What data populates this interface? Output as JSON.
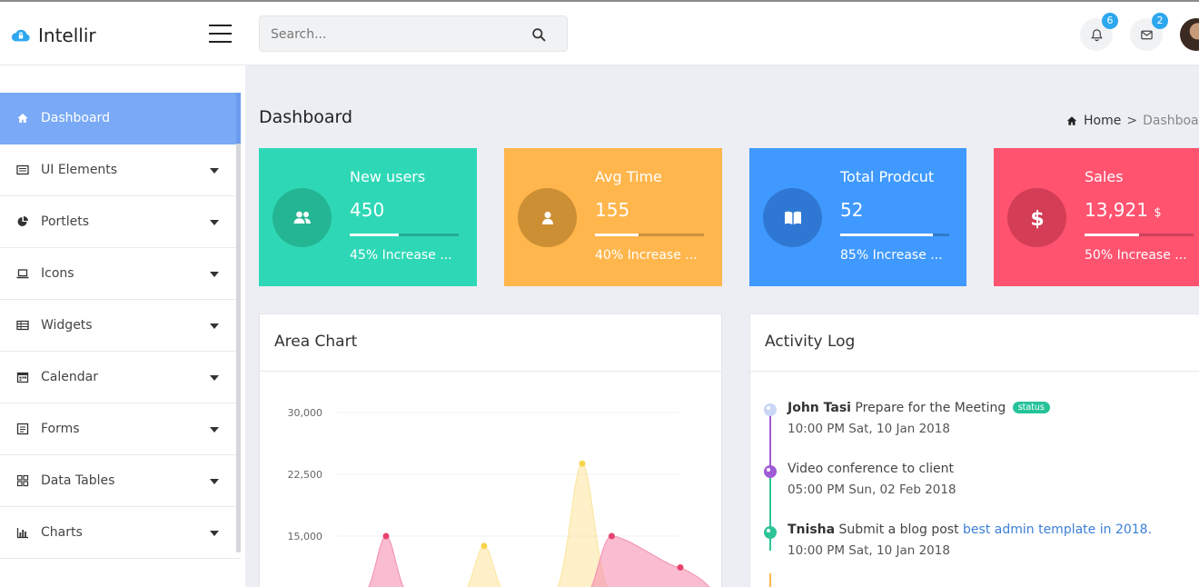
{
  "app": {
    "name": "Intellir"
  },
  "search": {
    "placeholder": "Search..."
  },
  "header": {
    "notifications_count": "6",
    "messages_count": "2"
  },
  "sidebar": {
    "items": [
      {
        "label": "Dashboard",
        "icon": "home-icon",
        "active": true
      },
      {
        "label": "UI Elements",
        "icon": "window-icon",
        "expandable": true
      },
      {
        "label": "Portlets",
        "icon": "pie-icon",
        "expandable": true
      },
      {
        "label": "Icons",
        "icon": "laptop-icon",
        "expandable": true
      },
      {
        "label": "Widgets",
        "icon": "table-icon",
        "expandable": true
      },
      {
        "label": "Calendar",
        "icon": "calendar-icon",
        "expandable": true
      },
      {
        "label": "Forms",
        "icon": "form-icon",
        "expandable": true
      },
      {
        "label": "Data Tables",
        "icon": "grid-icon",
        "expandable": true
      },
      {
        "label": "Charts",
        "icon": "bar-chart-icon",
        "expandable": true
      }
    ]
  },
  "page": {
    "title": "Dashboard",
    "breadcrumb": {
      "home": "Home",
      "current": "Dashboard"
    }
  },
  "stats": [
    {
      "title": "New users",
      "value": "450",
      "unit": "",
      "desc": "45% Increase ...",
      "progress": 0.45,
      "color": "#2ed8b6",
      "circle": "#24b592",
      "icon": "users-icon"
    },
    {
      "title": "Avg Time",
      "value": "155",
      "unit": "",
      "desc": "40% Increase ...",
      "progress": 0.4,
      "color": "#ffb64d",
      "circle": "#cc8f33",
      "icon": "user-icon"
    },
    {
      "title": "Total Prodcut",
      "value": "52",
      "unit": "",
      "desc": "85% Increase ...",
      "progress": 0.85,
      "color": "#4099ff",
      "circle": "#2e78d3",
      "icon": "book-icon"
    },
    {
      "title": "Sales",
      "value": "13,921",
      "unit": "$",
      "desc": "50% Increase ...",
      "progress": 0.5,
      "color": "#ff5370",
      "circle": "#d33d55",
      "icon": "dollar-icon"
    }
  ],
  "area_chart": {
    "title": "Area Chart"
  },
  "chart_data": {
    "type": "area",
    "title": "Area Chart",
    "ytick_labels": [
      "30,000",
      "22,500",
      "15,000"
    ],
    "ylim": [
      7500,
      30000
    ],
    "grid": true,
    "series": [
      {
        "color": "#f58fb0",
        "points": [
          [
            1,
            15000
          ],
          [
            3.3,
            15000
          ],
          [
            4,
            11200
          ]
        ]
      },
      {
        "color": "#fde49a",
        "points": [
          [
            2.0,
            13800
          ],
          [
            3.0,
            23800
          ]
        ]
      }
    ]
  },
  "activity": {
    "title": "Activity Log",
    "entries": [
      {
        "name": "John Tasi",
        "text": "Prepare for the Meeting",
        "badge": "status",
        "link": "",
        "time": "10:00 PM Sat, 10 Jan 2018",
        "color": "#c9d6f4"
      },
      {
        "name": "",
        "text": "Video conference to client",
        "badge": "",
        "link": "",
        "time": "05:00 PM Sun, 02 Feb 2018",
        "color": "#a05bd6"
      },
      {
        "name": "Tnisha",
        "text": "Submit a blog post",
        "badge": "",
        "link": "best admin template in 2018.",
        "time": "10:00 PM Sat, 10 Jan 2018",
        "color": "#2ec497"
      }
    ]
  }
}
